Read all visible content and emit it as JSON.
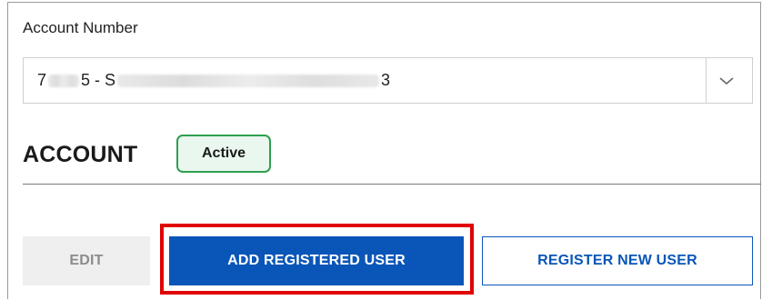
{
  "account_field": {
    "label": "Account Number",
    "value_prefix": "7",
    "value_middle": "5 - S",
    "value_suffix": "3"
  },
  "section": {
    "title": "ACCOUNT",
    "status": "Active"
  },
  "buttons": {
    "edit": "EDIT",
    "add_registered_user": "ADD REGISTERED USER",
    "register_new_user": "REGISTER NEW USER"
  },
  "colors": {
    "primary": "#0a56b8",
    "status_green": "#2e9e4f",
    "highlight_red": "#e00000"
  },
  "icons": {
    "dropdown": "chevron-down-icon"
  }
}
